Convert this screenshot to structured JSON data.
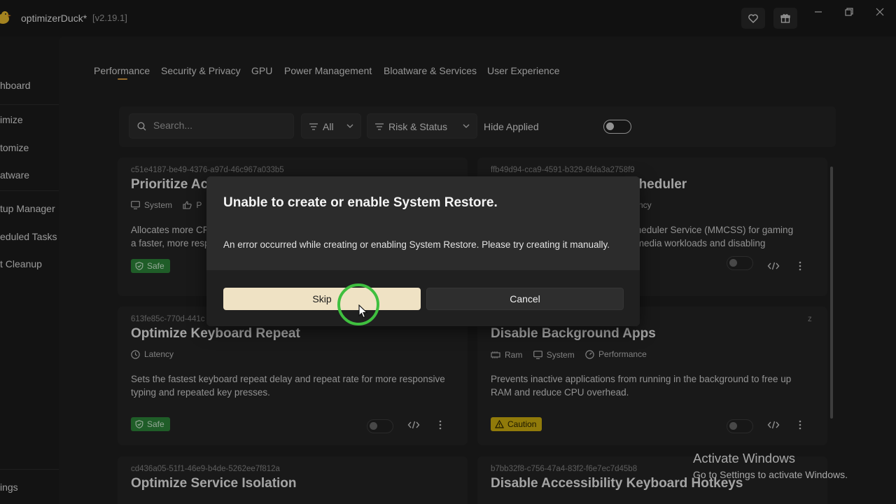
{
  "titlebar": {
    "app_name": "optimizerDuck*",
    "version": "[v2.19.1]",
    "icons": [
      "duck-logo-icon",
      "heart-icon",
      "gift-icon",
      "minimize-icon",
      "maximize-icon",
      "close-icon"
    ]
  },
  "sidebar": {
    "items": [
      {
        "label": "hboard"
      },
      {
        "label": "imize"
      },
      {
        "label": "tomize"
      },
      {
        "label": "atware"
      },
      {
        "label": "tup Manager"
      },
      {
        "label": "eduled Tasks"
      },
      {
        "label": "t Cleanup"
      }
    ],
    "settings_label": "ings"
  },
  "tabs": [
    {
      "label": "Performance",
      "active": true
    },
    {
      "label": "Security & Privacy"
    },
    {
      "label": "GPU"
    },
    {
      "label": "Power Management"
    },
    {
      "label": "Bloatware & Services"
    },
    {
      "label": "User Experience"
    }
  ],
  "filters": {
    "search_placeholder": "Search...",
    "category_value": "All",
    "risk_status_label": "Risk & Status",
    "hide_applied_label": "Hide Applied"
  },
  "cards": [
    {
      "id": "c51e4187-be49-4376-a97d-46c967a033b5",
      "title": "Prioritize Ac",
      "tags": [
        "System",
        "P"
      ],
      "description": "Allocates more CF a faster, more resp",
      "desc_line1": "Allocates more CF",
      "desc_line2": "a faster, more resp",
      "badge": "Safe"
    },
    {
      "id": "ffb49d94-cca9-4591-b329-6fda3a2758f9",
      "title": "cheduler",
      "tags": [
        "tency"
      ],
      "desc_line1": "cheduler Service (MMCSS) for gaming",
      "desc_line2": "timedia workloads and disabling"
    },
    {
      "id": "613fe85c-770d-441c",
      "title": "Optimize Keyboard Repeat",
      "tags": [
        "Latency"
      ],
      "desc_line1": "Sets the fastest keyboard repeat delay and repeat rate for more responsive",
      "desc_line2": "typing and repeated key presses.",
      "badge": "Safe"
    },
    {
      "id": "z",
      "title": "Disable Background Apps",
      "tags": [
        "Ram",
        "System",
        "Performance"
      ],
      "desc_line1": "Prevents inactive applications from running in the background to free up",
      "desc_line2": "RAM and reduce CPU overhead.",
      "badge": "Caution"
    },
    {
      "id": "cd436a05-51f1-46e9-b4de-5262ee7f812a",
      "title": "Optimize Service Isolation"
    },
    {
      "id": "b7bb32f8-c756-47a4-83f2-f6e7ec7d45b8",
      "title": "Disable Accessibility Keyboard Hotkeys"
    }
  ],
  "dialog": {
    "title": "Unable to create or enable System Restore.",
    "message": "An error occurred while creating or enabling System Restore. Please try creating it manually.",
    "skip_label": "Skip",
    "cancel_label": "Cancel"
  },
  "watermark": {
    "line1": "Activate Windows",
    "line2": "Go to Settings to activate Windows."
  },
  "colors": {
    "accent": "#e0a040",
    "safe": "#2e8a3c",
    "caution": "#d4b40f",
    "skip_button": "#efe2c4",
    "click_ring": "#3fbf3f"
  }
}
